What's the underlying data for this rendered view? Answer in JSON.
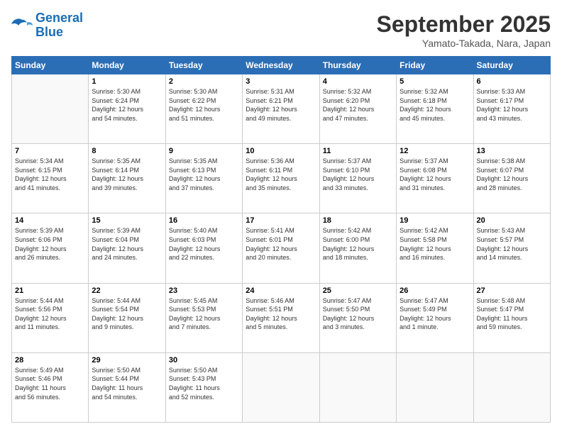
{
  "logo": {
    "line1": "General",
    "line2": "Blue"
  },
  "title": "September 2025",
  "location": "Yamato-Takada, Nara, Japan",
  "days_of_week": [
    "Sunday",
    "Monday",
    "Tuesday",
    "Wednesday",
    "Thursday",
    "Friday",
    "Saturday"
  ],
  "weeks": [
    [
      {
        "day": "",
        "info": ""
      },
      {
        "day": "1",
        "info": "Sunrise: 5:30 AM\nSunset: 6:24 PM\nDaylight: 12 hours\nand 54 minutes."
      },
      {
        "day": "2",
        "info": "Sunrise: 5:30 AM\nSunset: 6:22 PM\nDaylight: 12 hours\nand 51 minutes."
      },
      {
        "day": "3",
        "info": "Sunrise: 5:31 AM\nSunset: 6:21 PM\nDaylight: 12 hours\nand 49 minutes."
      },
      {
        "day": "4",
        "info": "Sunrise: 5:32 AM\nSunset: 6:20 PM\nDaylight: 12 hours\nand 47 minutes."
      },
      {
        "day": "5",
        "info": "Sunrise: 5:32 AM\nSunset: 6:18 PM\nDaylight: 12 hours\nand 45 minutes."
      },
      {
        "day": "6",
        "info": "Sunrise: 5:33 AM\nSunset: 6:17 PM\nDaylight: 12 hours\nand 43 minutes."
      }
    ],
    [
      {
        "day": "7",
        "info": "Sunrise: 5:34 AM\nSunset: 6:15 PM\nDaylight: 12 hours\nand 41 minutes."
      },
      {
        "day": "8",
        "info": "Sunrise: 5:35 AM\nSunset: 6:14 PM\nDaylight: 12 hours\nand 39 minutes."
      },
      {
        "day": "9",
        "info": "Sunrise: 5:35 AM\nSunset: 6:13 PM\nDaylight: 12 hours\nand 37 minutes."
      },
      {
        "day": "10",
        "info": "Sunrise: 5:36 AM\nSunset: 6:11 PM\nDaylight: 12 hours\nand 35 minutes."
      },
      {
        "day": "11",
        "info": "Sunrise: 5:37 AM\nSunset: 6:10 PM\nDaylight: 12 hours\nand 33 minutes."
      },
      {
        "day": "12",
        "info": "Sunrise: 5:37 AM\nSunset: 6:08 PM\nDaylight: 12 hours\nand 31 minutes."
      },
      {
        "day": "13",
        "info": "Sunrise: 5:38 AM\nSunset: 6:07 PM\nDaylight: 12 hours\nand 28 minutes."
      }
    ],
    [
      {
        "day": "14",
        "info": "Sunrise: 5:39 AM\nSunset: 6:06 PM\nDaylight: 12 hours\nand 26 minutes."
      },
      {
        "day": "15",
        "info": "Sunrise: 5:39 AM\nSunset: 6:04 PM\nDaylight: 12 hours\nand 24 minutes."
      },
      {
        "day": "16",
        "info": "Sunrise: 5:40 AM\nSunset: 6:03 PM\nDaylight: 12 hours\nand 22 minutes."
      },
      {
        "day": "17",
        "info": "Sunrise: 5:41 AM\nSunset: 6:01 PM\nDaylight: 12 hours\nand 20 minutes."
      },
      {
        "day": "18",
        "info": "Sunrise: 5:42 AM\nSunset: 6:00 PM\nDaylight: 12 hours\nand 18 minutes."
      },
      {
        "day": "19",
        "info": "Sunrise: 5:42 AM\nSunset: 5:58 PM\nDaylight: 12 hours\nand 16 minutes."
      },
      {
        "day": "20",
        "info": "Sunrise: 5:43 AM\nSunset: 5:57 PM\nDaylight: 12 hours\nand 14 minutes."
      }
    ],
    [
      {
        "day": "21",
        "info": "Sunrise: 5:44 AM\nSunset: 5:56 PM\nDaylight: 12 hours\nand 11 minutes."
      },
      {
        "day": "22",
        "info": "Sunrise: 5:44 AM\nSunset: 5:54 PM\nDaylight: 12 hours\nand 9 minutes."
      },
      {
        "day": "23",
        "info": "Sunrise: 5:45 AM\nSunset: 5:53 PM\nDaylight: 12 hours\nand 7 minutes."
      },
      {
        "day": "24",
        "info": "Sunrise: 5:46 AM\nSunset: 5:51 PM\nDaylight: 12 hours\nand 5 minutes."
      },
      {
        "day": "25",
        "info": "Sunrise: 5:47 AM\nSunset: 5:50 PM\nDaylight: 12 hours\nand 3 minutes."
      },
      {
        "day": "26",
        "info": "Sunrise: 5:47 AM\nSunset: 5:49 PM\nDaylight: 12 hours\nand 1 minute."
      },
      {
        "day": "27",
        "info": "Sunrise: 5:48 AM\nSunset: 5:47 PM\nDaylight: 11 hours\nand 59 minutes."
      }
    ],
    [
      {
        "day": "28",
        "info": "Sunrise: 5:49 AM\nSunset: 5:46 PM\nDaylight: 11 hours\nand 56 minutes."
      },
      {
        "day": "29",
        "info": "Sunrise: 5:50 AM\nSunset: 5:44 PM\nDaylight: 11 hours\nand 54 minutes."
      },
      {
        "day": "30",
        "info": "Sunrise: 5:50 AM\nSunset: 5:43 PM\nDaylight: 11 hours\nand 52 minutes."
      },
      {
        "day": "",
        "info": ""
      },
      {
        "day": "",
        "info": ""
      },
      {
        "day": "",
        "info": ""
      },
      {
        "day": "",
        "info": ""
      }
    ]
  ]
}
